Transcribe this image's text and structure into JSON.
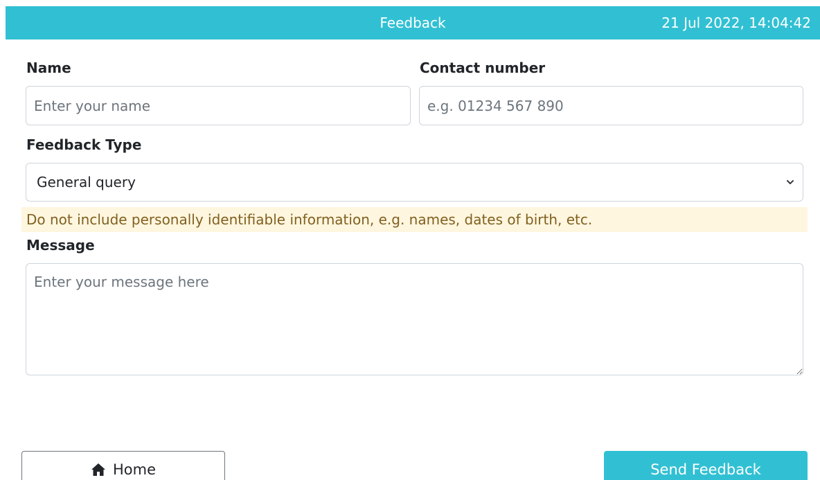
{
  "header": {
    "title": "Feedback",
    "datetime": "21 Jul 2022, 14:04:42",
    "background_color": "#31c0d3"
  },
  "form": {
    "name": {
      "label": "Name",
      "placeholder": "Enter your name",
      "value": ""
    },
    "contact": {
      "label": "Contact number",
      "placeholder": "e.g. 01234 567 890",
      "value": ""
    },
    "feedback_type": {
      "label": "Feedback Type",
      "selected": "General query",
      "icon": "chevron-down-icon"
    },
    "notice": "Do not include personally identifiable information, e.g. names, dates of birth, etc.",
    "message": {
      "label": "Message",
      "placeholder": "Enter your message here",
      "value": ""
    }
  },
  "actions": {
    "home_label": "Home",
    "home_icon": "home-icon",
    "send_label": "Send Feedback",
    "send_color": "#31c0d3"
  }
}
